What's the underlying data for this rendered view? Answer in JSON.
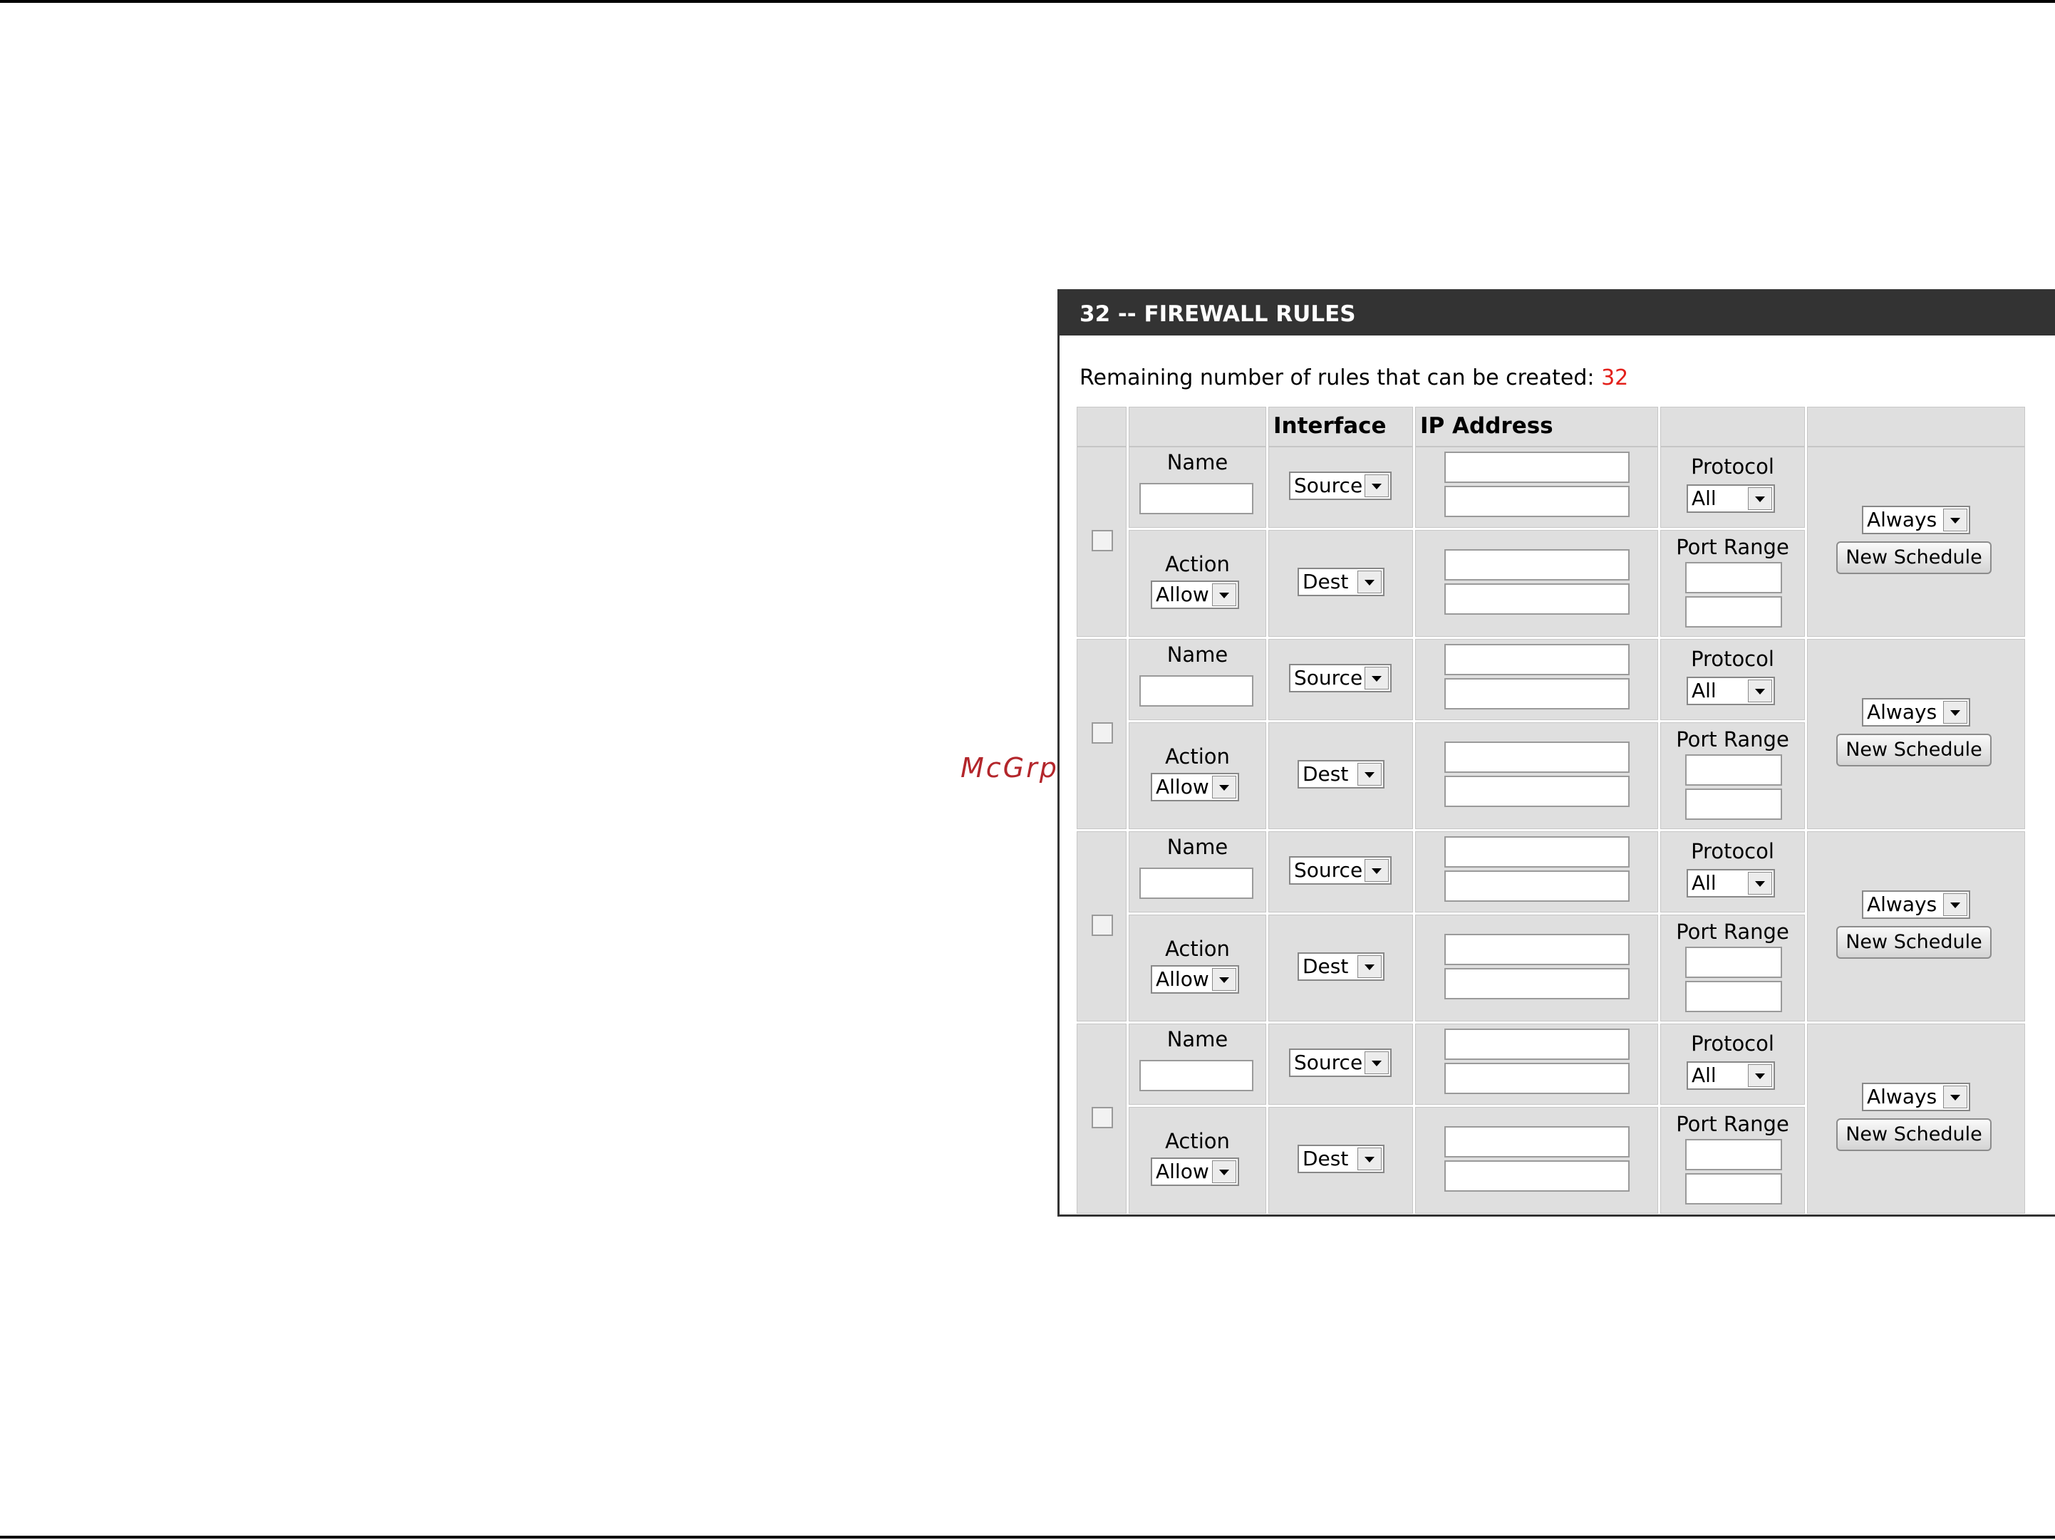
{
  "watermark": "McGrp.Ru",
  "panel": {
    "title": "32 -- FIREWALL RULES",
    "remaining_label": "Remaining number of rules that can be created:",
    "remaining_count": "32"
  },
  "columns": {
    "interface": "Interface",
    "ip_address": "IP Address"
  },
  "rule_labels": {
    "name": "Name",
    "action": "Action",
    "protocol": "Protocol",
    "port_range": "Port Range",
    "new_schedule": "New Schedule"
  },
  "rules": [
    {
      "source": "Source",
      "dest": "Dest",
      "action": "Allow",
      "protocol": "All",
      "schedule": "Always",
      "checked": false
    },
    {
      "source": "Source",
      "dest": "Dest",
      "action": "Allow",
      "protocol": "All",
      "schedule": "Always",
      "checked": false
    },
    {
      "source": "Source",
      "dest": "Dest",
      "action": "Allow",
      "protocol": "All",
      "schedule": "Always",
      "checked": false
    },
    {
      "source": "Source",
      "dest": "Dest",
      "action": "Allow",
      "protocol": "All",
      "schedule": "Always",
      "checked": false
    }
  ],
  "colors": {
    "header_bg": "#333333",
    "count_red": "#e3201b",
    "cell_bg": "#dfdfdf",
    "watermark": "#b3262b"
  }
}
